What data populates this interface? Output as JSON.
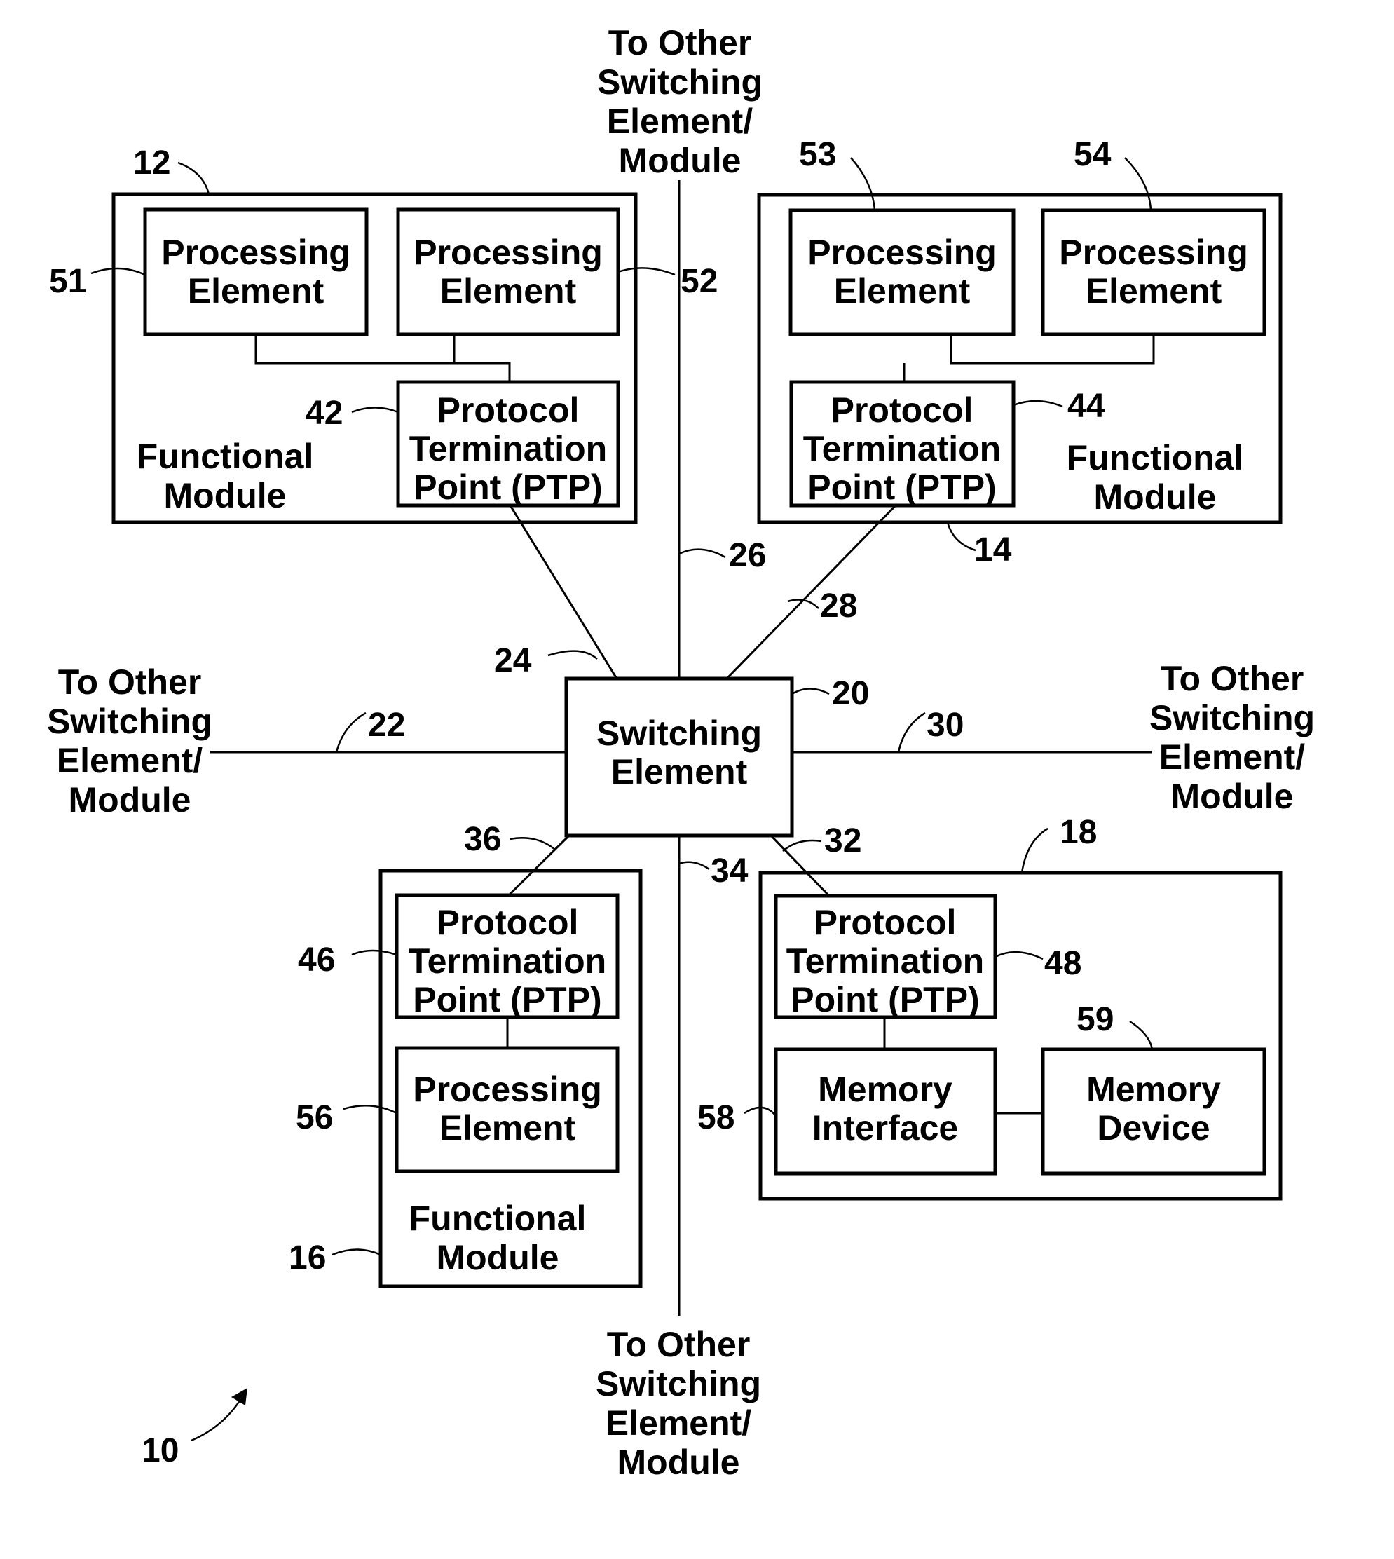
{
  "figure": {
    "reference": "10",
    "switching_element": {
      "ref": "20",
      "lines": [
        "Switching",
        "Element"
      ]
    },
    "external_link_label": [
      "To Other",
      "Switching",
      "Element/",
      "Module"
    ],
    "links": {
      "west": "22",
      "to_module_12": "24",
      "north": "26",
      "to_module_14": "28",
      "east": "30",
      "to_module_18": "32",
      "south": "34",
      "to_module_16": "36"
    },
    "modules": {
      "m12": {
        "ref": "12",
        "label": [
          "Functional",
          "Module"
        ],
        "pe_a": {
          "ref": "51",
          "lines": [
            "Processing",
            "Element"
          ]
        },
        "pe_b": {
          "ref": "52",
          "lines": [
            "Processing",
            "Element"
          ]
        },
        "ptp": {
          "ref": "42",
          "lines": [
            "Protocol",
            "Termination",
            "Point (PTP)"
          ]
        }
      },
      "m14": {
        "ref": "14",
        "label": [
          "Functional",
          "Module"
        ],
        "pe_a": {
          "ref": "53",
          "lines": [
            "Processing",
            "Element"
          ]
        },
        "pe_b": {
          "ref": "54",
          "lines": [
            "Processing",
            "Element"
          ]
        },
        "ptp": {
          "ref": "44",
          "lines": [
            "Protocol",
            "Termination",
            "Point (PTP)"
          ]
        }
      },
      "m16": {
        "ref": "16",
        "label": [
          "Functional",
          "Module"
        ],
        "ptp": {
          "ref": "46",
          "lines": [
            "Protocol",
            "Termination",
            "Point (PTP)"
          ]
        },
        "pe": {
          "ref": "56",
          "lines": [
            "Processing",
            "Element"
          ]
        }
      },
      "m18": {
        "ref": "18",
        "ptp": {
          "ref": "48",
          "lines": [
            "Protocol",
            "Termination",
            "Point (PTP)"
          ]
        },
        "mem_if": {
          "ref": "58",
          "lines": [
            "Memory",
            "Interface"
          ]
        },
        "mem_dev": {
          "ref": "59",
          "lines": [
            "Memory",
            "Device"
          ]
        }
      }
    }
  }
}
